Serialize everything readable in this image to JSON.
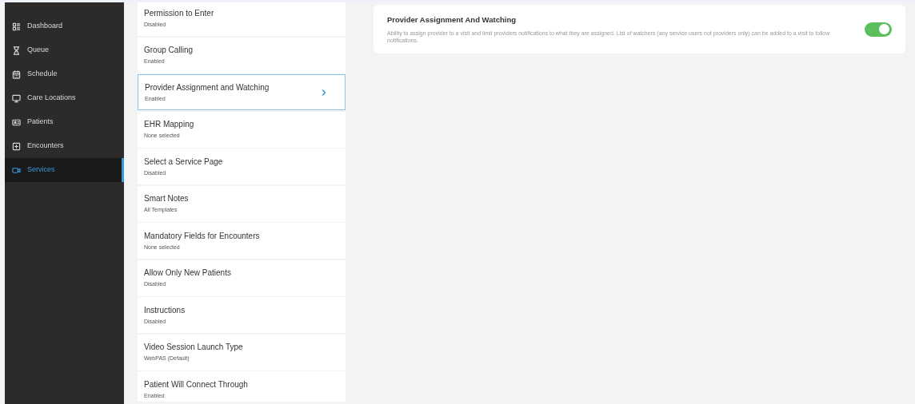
{
  "sidebar": {
    "items": [
      {
        "label": "Dashboard",
        "kind": "dashboard",
        "selected": false
      },
      {
        "label": "Queue",
        "kind": "queue",
        "selected": false
      },
      {
        "label": "Schedule",
        "kind": "schedule",
        "selected": false
      },
      {
        "label": "Care Locations",
        "kind": "locations",
        "selected": false
      },
      {
        "label": "Patients",
        "kind": "patients",
        "selected": false
      },
      {
        "label": "Encounters",
        "kind": "encounters",
        "selected": false
      },
      {
        "label": "Services",
        "kind": "services",
        "selected": true
      }
    ]
  },
  "settings_list": [
    {
      "title": "Permission to Enter",
      "value": "Disabled",
      "selected": false
    },
    {
      "title": "Group Calling",
      "value": "Enabled",
      "selected": false
    },
    {
      "title": "Provider Assignment and Watching",
      "value": "Enabled",
      "selected": true
    },
    {
      "title": "EHR Mapping",
      "value": "None selected",
      "selected": false
    },
    {
      "title": "Select a Service Page",
      "value": "Disabled",
      "selected": false
    },
    {
      "title": "Smart Notes",
      "value": "All Templates",
      "selected": false
    },
    {
      "title": "Mandatory Fields for Encounters",
      "value": "None selected",
      "selected": false
    },
    {
      "title": "Allow Only New Patients",
      "value": "Disabled",
      "selected": false
    },
    {
      "title": "Instructions",
      "value": "Disabled",
      "selected": false
    },
    {
      "title": "Video Session Launch Type",
      "value": "WebPAS (Default)",
      "selected": false
    },
    {
      "title": "Patient Will Connect Through",
      "value": "Enabled",
      "selected": false
    }
  ],
  "detail": {
    "title": "Provider Assignment And Watching",
    "description": "Ability to assign provider to a visit and limit providers notifications to what they are assigned. List of watchers (any service users not providers only) can be added to a visit to follow notifications.",
    "on": true
  }
}
